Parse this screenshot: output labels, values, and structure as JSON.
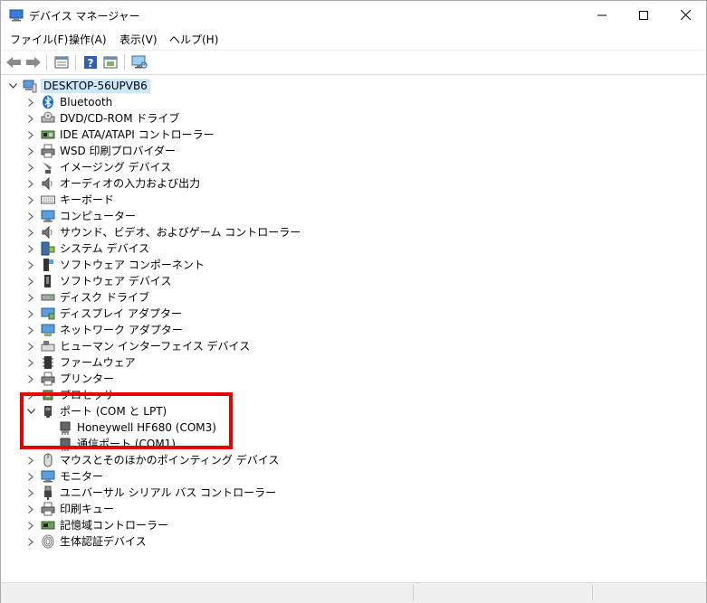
{
  "window": {
    "title": "デバイス マネージャー",
    "controls": [
      "minimize",
      "maximize",
      "close"
    ]
  },
  "menu": [
    "ファイル(F)",
    "操作(A)",
    "表示(V)",
    "ヘルプ(H)"
  ],
  "toolbar_icons": [
    "back-icon",
    "forward-icon",
    "properties-icon",
    "help-icon",
    "update-driver-icon",
    "monitor-scan-icon"
  ],
  "tree": {
    "root": "DESKTOP-56UPVB6",
    "categories": [
      {
        "label": "Bluetooth",
        "icon": "bluetooth-icon"
      },
      {
        "label": "DVD/CD-ROM ドライブ",
        "icon": "dvd-drive-icon"
      },
      {
        "label": "IDE ATA/ATAPI コントローラー",
        "icon": "ide-controller-icon"
      },
      {
        "label": "WSD 印刷プロバイダー",
        "icon": "printer-provider-icon"
      },
      {
        "label": "イメージング デバイス",
        "icon": "camera-icon"
      },
      {
        "label": "オーディオの入力および出力",
        "icon": "speaker-icon"
      },
      {
        "label": "キーボード",
        "icon": "keyboard-icon"
      },
      {
        "label": "コンピューター",
        "icon": "computer-icon"
      },
      {
        "label": "サウンド、ビデオ、およびゲーム コントローラー",
        "icon": "sound-icon"
      },
      {
        "label": "システム デバイス",
        "icon": "system-device-icon"
      },
      {
        "label": "ソフトウェア コンポーネント",
        "icon": "software-component-icon"
      },
      {
        "label": "ソフトウェア デバイス",
        "icon": "software-device-icon"
      },
      {
        "label": "ディスク ドライブ",
        "icon": "disk-drive-icon"
      },
      {
        "label": "ディスプレイ アダプター",
        "icon": "display-adapter-icon"
      },
      {
        "label": "ネットワーク アダプター",
        "icon": "network-adapter-icon"
      },
      {
        "label": "ヒューマン インターフェイス デバイス",
        "icon": "hid-icon"
      },
      {
        "label": "ファームウェア",
        "icon": "firmware-icon"
      },
      {
        "label": "プリンター",
        "icon": "printer-icon"
      },
      {
        "label": "プロセッサ",
        "icon": "processor-icon"
      }
    ],
    "ports": {
      "label": "ポート (COM と LPT)",
      "children": [
        {
          "label": "Honeywell HF680 (COM3)"
        },
        {
          "label": "通信ポート (COM1)"
        }
      ]
    },
    "categories_after": [
      {
        "label": "マウスとそのほかのポインティング デバイス",
        "icon": "mouse-icon"
      },
      {
        "label": "モニター",
        "icon": "monitor-icon"
      },
      {
        "label": "ユニバーサル シリアル バス コントローラー",
        "icon": "usb-icon"
      },
      {
        "label": "印刷キュー",
        "icon": "print-queue-icon"
      },
      {
        "label": "記憶域コントローラー",
        "icon": "storage-controller-icon"
      },
      {
        "label": "生体認証デバイス",
        "icon": "fingerprint-icon"
      }
    ]
  },
  "colors": {
    "highlight": "#e60000",
    "selection": "#cce8ff"
  }
}
